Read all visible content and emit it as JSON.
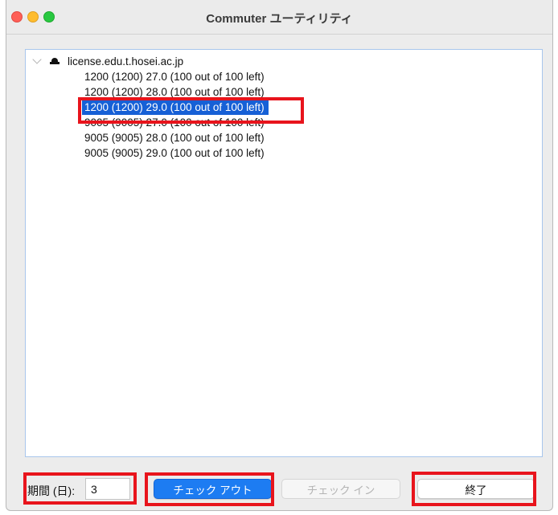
{
  "window": {
    "title": "Commuter ユーティリティ"
  },
  "tree": {
    "root_label": "license.edu.t.hosei.ac.jp",
    "items": [
      {
        "label": "1200 (1200) 27.0 (100 out of 100 left)",
        "selected": false
      },
      {
        "label": "1200 (1200) 28.0 (100 out of 100 left)",
        "selected": false
      },
      {
        "label": "1200 (1200) 29.0 (100 out of 100 left)",
        "selected": true
      },
      {
        "label": "9005 (9005) 27.0 (100 out of 100 left)",
        "selected": false
      },
      {
        "label": "9005 (9005) 28.0 (100 out of 100 left)",
        "selected": false
      },
      {
        "label": "9005 (9005) 29.0 (100 out of 100 left)",
        "selected": false
      }
    ]
  },
  "controls": {
    "period_label": "期間 (日):",
    "period_value": "3",
    "checkout_label": "チェック アウト",
    "checkin_label": "チェック イン",
    "exit_label": "終了"
  },
  "colors": {
    "selection": "#1660d6",
    "primary_button": "#1d7cf2",
    "highlight": "#e8141c"
  }
}
